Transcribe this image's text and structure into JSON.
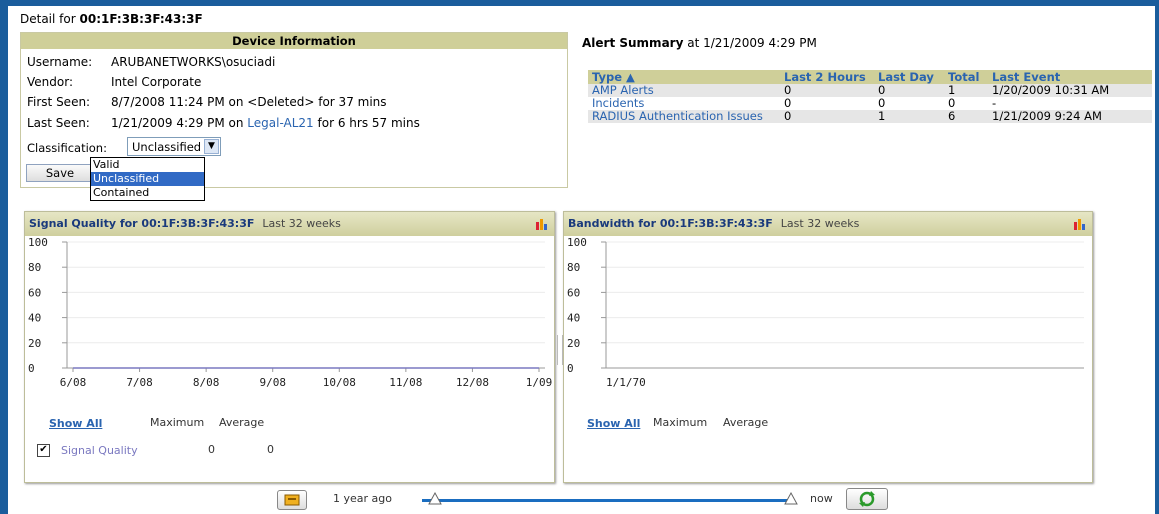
{
  "header": {
    "detail_prefix": "Detail for",
    "mac": "00:1F:3B:3F:43:3F"
  },
  "device": {
    "title": "Device Information",
    "username_label": "Username:",
    "username": "ARUBANETWORKS\\osuciadi",
    "vendor_label": "Vendor:",
    "vendor": "Intel Corporate",
    "first_seen_label": "First Seen:",
    "first_seen": "8/7/2008 11:24 PM on <Deleted> for 37 mins",
    "last_seen_label": "Last Seen:",
    "last_seen_pre": "1/21/2009 4:29 PM on",
    "last_seen_link": "Legal-AL21",
    "last_seen_post": "for 6 hrs 57 mins",
    "classification_label": "Classification:",
    "classification_value": "Unclassified",
    "classification_options": [
      "Valid",
      "Unclassified",
      "Contained"
    ],
    "save_label": "Save"
  },
  "alerts": {
    "title": "Alert Summary",
    "at": "at 1/21/2009 4:29 PM",
    "columns": [
      "Type ▲",
      "Last 2 Hours",
      "Last Day",
      "Total",
      "Last Event"
    ],
    "rows": [
      [
        "AMP Alerts",
        "0",
        "0",
        "1",
        "1/20/2009 10:31 AM"
      ],
      [
        "Incidents",
        "0",
        "0",
        "0",
        "-"
      ],
      [
        "RADIUS Authentication Issues",
        "0",
        "1",
        "6",
        "1/21/2009 9:24 AM"
      ]
    ]
  },
  "signal_chart": {
    "title": "Signal Quality for 00:1F:3B:3F:43:3F",
    "range": "Last 32 weeks",
    "show_all": "Show All",
    "max_label": "Maximum",
    "avg_label": "Average",
    "series_label": "Signal Quality",
    "series_max": "0",
    "series_avg": "0"
  },
  "bandwidth_chart": {
    "title": "Bandwidth for 00:1F:3B:3F:43:3F",
    "range": "Last 32 weeks",
    "show_all": "Show All",
    "max_label": "Maximum",
    "avg_label": "Average"
  },
  "slider": {
    "left_label": "1 year ago",
    "right_label": "now"
  },
  "colors": {
    "accent": "#1a5d9c",
    "header_bg": "#cfcf99",
    "link": "#2a64b0"
  },
  "chart_data": [
    {
      "type": "line",
      "title": "Signal Quality for 00:1F:3B:3F:43:3F",
      "categories": [
        "6/08",
        "7/08",
        "8/08",
        "9/08",
        "10/08",
        "11/08",
        "12/08",
        "1/09"
      ],
      "yticks": [
        "0",
        "20",
        "40",
        "60",
        "80",
        "100"
      ],
      "ylim": [
        0,
        100
      ],
      "series": [
        {
          "name": "Signal Quality",
          "values": [
            0,
            0,
            0,
            0,
            0,
            0,
            0,
            0
          ]
        }
      ]
    },
    {
      "type": "line",
      "title": "Bandwidth for 00:1F:3B:3F:43:3F",
      "categories": [
        "1/1/70"
      ],
      "yticks": [
        "0",
        "20",
        "40",
        "60",
        "80",
        "100"
      ],
      "ylim": [
        0,
        100
      ],
      "series": []
    }
  ]
}
